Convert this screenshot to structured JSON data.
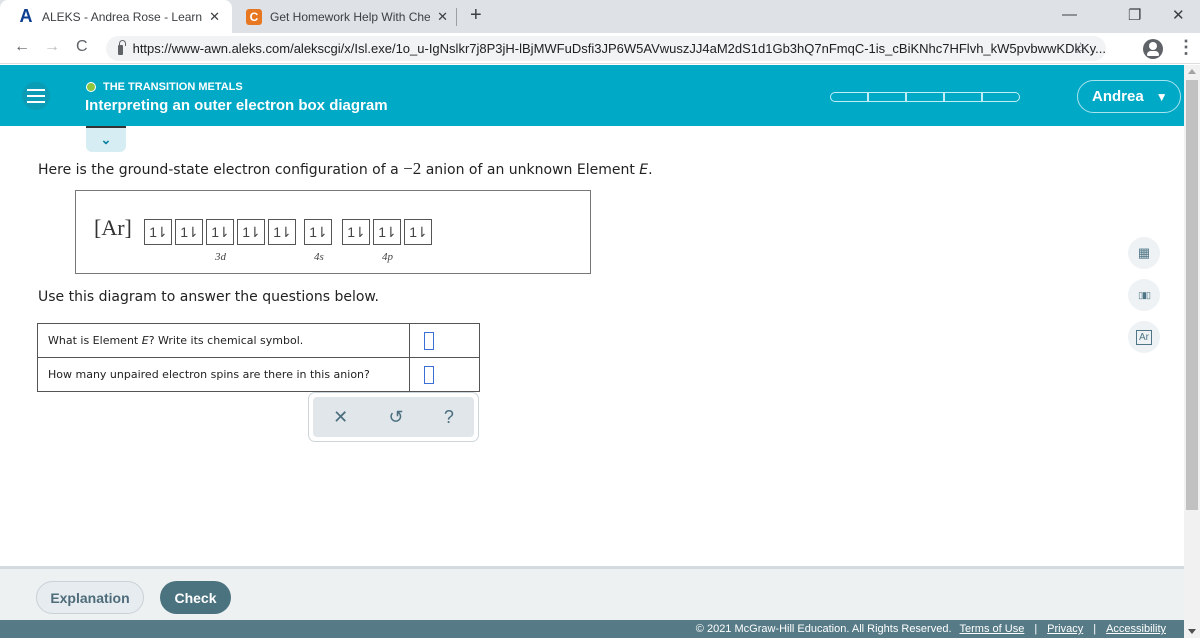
{
  "browser": {
    "tabs": [
      {
        "label": "ALEKS - Andrea Rose - Learn",
        "favicon": "A",
        "active": true
      },
      {
        "label": "Get Homework Help With Chegg",
        "favicon": "C",
        "active": false
      }
    ],
    "close_glyph": "✕",
    "new_tab_glyph": "+",
    "url": "https://www-awn.aleks.com/alekscgi/x/Isl.exe/1o_u-IgNslkr7j8P3jH-lBjMWFuDsfi3JP6W5AVwuszJJ4aM2dS1d1Gb3hQ7nFmqC-1is_cBiKNhc7HFlvh_kW5pvbwwKDkKy...",
    "nav": {
      "back": "←",
      "forward": "→",
      "reload": "C"
    },
    "window": {
      "minimize": "—",
      "restore": "❐",
      "close": "✕"
    },
    "star": "☆",
    "menu": "⋮"
  },
  "header": {
    "topic": "THE TRANSITION METALS",
    "title": "Interpreting an outer electron box diagram",
    "progress_segments": 5,
    "progress_filled": 0,
    "user": "Andrea",
    "user_chevron": "⌄",
    "collapse_chevron": "⌄",
    "colors": {
      "header_bg": "#00a9c6",
      "topic_dot": "#8dc63f"
    }
  },
  "problem": {
    "intro_prefix": "Here is the ground-state electron configuration of a ",
    "charge": "−2",
    "intro_middle": " anion of an unknown Element ",
    "element_var": "E",
    "intro_suffix": ".",
    "core": "[Ar]",
    "orbitals": [
      {
        "label": "3d",
        "boxes": [
          "1⇂",
          "1⇂",
          "1⇂",
          "1⇂",
          "1⇂"
        ]
      },
      {
        "label": "4s",
        "boxes": [
          "1⇂"
        ]
      },
      {
        "label": "4p",
        "boxes": [
          "1⇂",
          "1⇂",
          "1⇂"
        ]
      }
    ],
    "use_text": "Use this diagram to answer the questions below.",
    "questions": [
      {
        "text_prefix": "What is Element ",
        "var": "E",
        "text_suffix": "? Write its chemical symbol.",
        "answer": ""
      },
      {
        "text_prefix": "How many unpaired electron spins are there in this anion?",
        "var": "",
        "text_suffix": "",
        "answer": ""
      }
    ],
    "tools": {
      "clear": "✕",
      "undo": "↺",
      "help": "?"
    }
  },
  "side_tools": [
    {
      "name": "calculator-icon",
      "glyph": "▦"
    },
    {
      "name": "chart-icon",
      "glyph": "▯▮▯"
    },
    {
      "name": "periodic-table-icon",
      "glyph": "Ar"
    }
  ],
  "footer": {
    "explanation": "Explanation",
    "check": "Check",
    "copyright": "© 2021 McGraw-Hill Education. All Rights Reserved.",
    "links": [
      "Terms of Use",
      "Privacy",
      "Accessibility"
    ],
    "separator": "|"
  }
}
